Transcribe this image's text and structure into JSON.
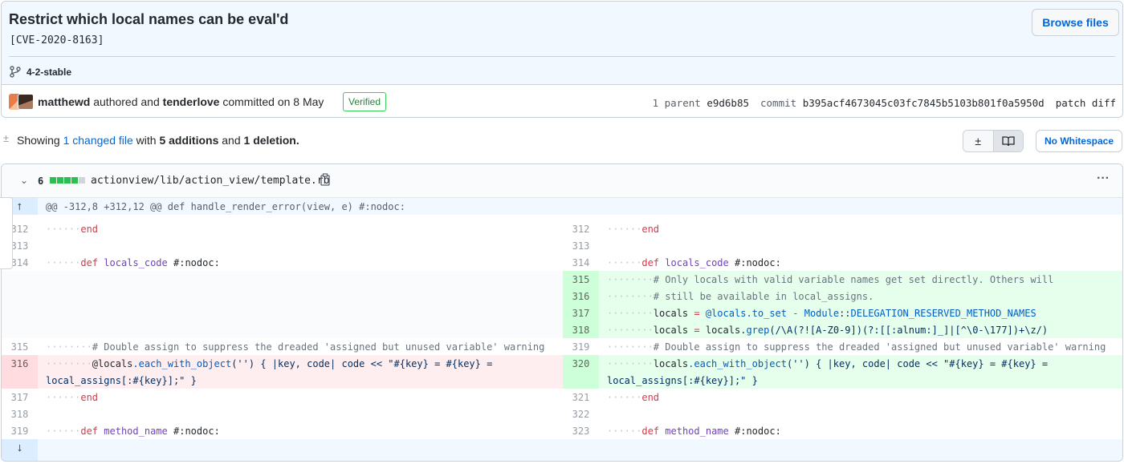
{
  "commit": {
    "title": "Restrict which local names can be eval'd",
    "description": "[CVE-2020-8163]",
    "branch": "4-2-stable",
    "browse_files": "Browse files",
    "author": "matthewd",
    "authored_text": "authored and",
    "committer": "tenderlove",
    "committed_text": "committed on 8 May",
    "verified": "Verified",
    "parent_label": "1 parent",
    "parent_sha": "e9d6b85",
    "commit_label": "commit",
    "commit_sha": "b395acf4673045c03fc7845b5103b801f0a5950d",
    "patch_label": "patch",
    "diff_label": "diff"
  },
  "toolbar": {
    "showing_prefix": "Showing",
    "changed_files": "1 changed file",
    "with_text": "with",
    "additions": "5 additions",
    "and_text": "and",
    "deletions": "1 deletion.",
    "no_whitespace": "No Whitespace"
  },
  "file": {
    "change_count": "6",
    "path": "actionview/lib/action_view/template.rb",
    "diffstat": {
      "additions": 4,
      "deletions": 0,
      "neutral": 1
    }
  },
  "diff": {
    "hunk": "@@ -312,8 +312,12 @@ def handle_render_error(view, e) #:nodoc:",
    "lines": {
      "l312": "312",
      "l313": "313",
      "l314": "314",
      "l315": "315",
      "l316": "316",
      "l317": "317",
      "l318": "318",
      "l319": "319",
      "r312": "312",
      "r313": "313",
      "r314": "314",
      "r315": "315",
      "r316": "316",
      "r317": "317",
      "r318": "318",
      "r319": "319",
      "r320": "320",
      "r321": "321",
      "r322": "322",
      "r323": "323"
    },
    "tokens": {
      "end": "end",
      "def": "def",
      "locals_code": "locals_code",
      "nodoc": "#:nodoc:",
      "comment_only_locals": "# Only locals with valid variable names get set directly. Others will",
      "comment_still": "# still be available in local_assigns.",
      "locals": "locals",
      "eq": "=",
      "at_locals": "@locals",
      "dot_to_set": ".to_set",
      "minus": "-",
      "module": "Module",
      "colons": "::",
      "delegation": "DELEGATION_RESERVED_METHOD_NAMES",
      "locals_grep_prefix": "locals.",
      "grep": "grep",
      "regex": "(/\\A(?![A-Z0-9])(?:[[:alnum:]_]|[^\\0-\\177])+\\z/)",
      "comment_double": "# Double assign to suppress the dreaded 'assigned but unused variable' warning",
      "each_with_object": ".each_with_object",
      "ewo_args": "('') { |key, code| code << \"#{key} = #{key} =",
      "ewo_cont": "local_assigns[:#{key}];\" }",
      "method_name": "method_name"
    }
  }
}
